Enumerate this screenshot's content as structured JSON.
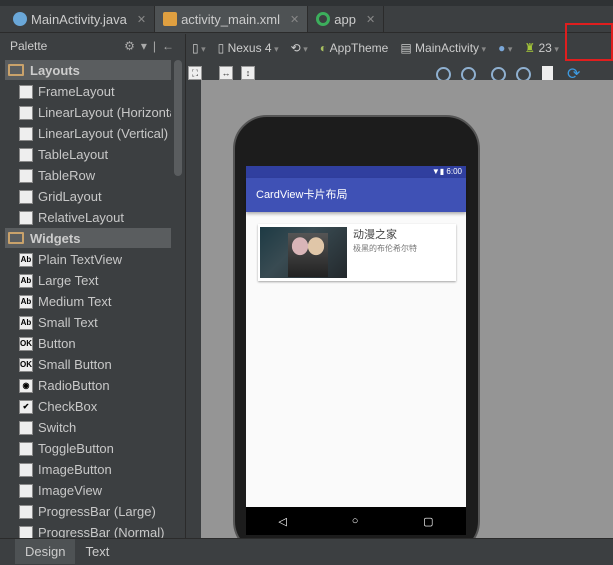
{
  "editor_tabs": [
    {
      "label": "MainActivity.java",
      "icon": "java-class-icon",
      "active": false
    },
    {
      "label": "activity_main.xml",
      "icon": "xml-layout-icon",
      "active": true
    },
    {
      "label": "app",
      "icon": "android-app-icon",
      "active": false
    }
  ],
  "palette": {
    "title": "Palette",
    "groups": [
      {
        "label": "Layouts",
        "items": [
          "FrameLayout",
          "LinearLayout (Horizontal)",
          "LinearLayout (Vertical)",
          "TableLayout",
          "TableRow",
          "GridLayout",
          "RelativeLayout"
        ]
      },
      {
        "label": "Widgets",
        "items": [
          "Plain TextView",
          "Large Text",
          "Medium Text",
          "Small Text",
          "Button",
          "Small Button",
          "RadioButton",
          "CheckBox",
          "Switch",
          "ToggleButton",
          "ImageButton",
          "ImageView",
          "ProgressBar (Large)",
          "ProgressBar (Normal)"
        ]
      }
    ]
  },
  "toolbar": {
    "device": "Nexus 4",
    "theme": "AppTheme",
    "activity": "MainActivity",
    "api": "23"
  },
  "preview": {
    "time": "6:00",
    "app_title": "CardView卡片布局",
    "card_title": "动漫之家",
    "card_subtitle": "极黑的布伦希尔特",
    "nav": [
      "◁",
      "○",
      "▢"
    ]
  },
  "bottom_tabs": [
    "Design",
    "Text"
  ],
  "colors": {
    "primary": "#3f51b5",
    "primary_dark": "#303f9f",
    "highlight": "#e01e1e"
  }
}
